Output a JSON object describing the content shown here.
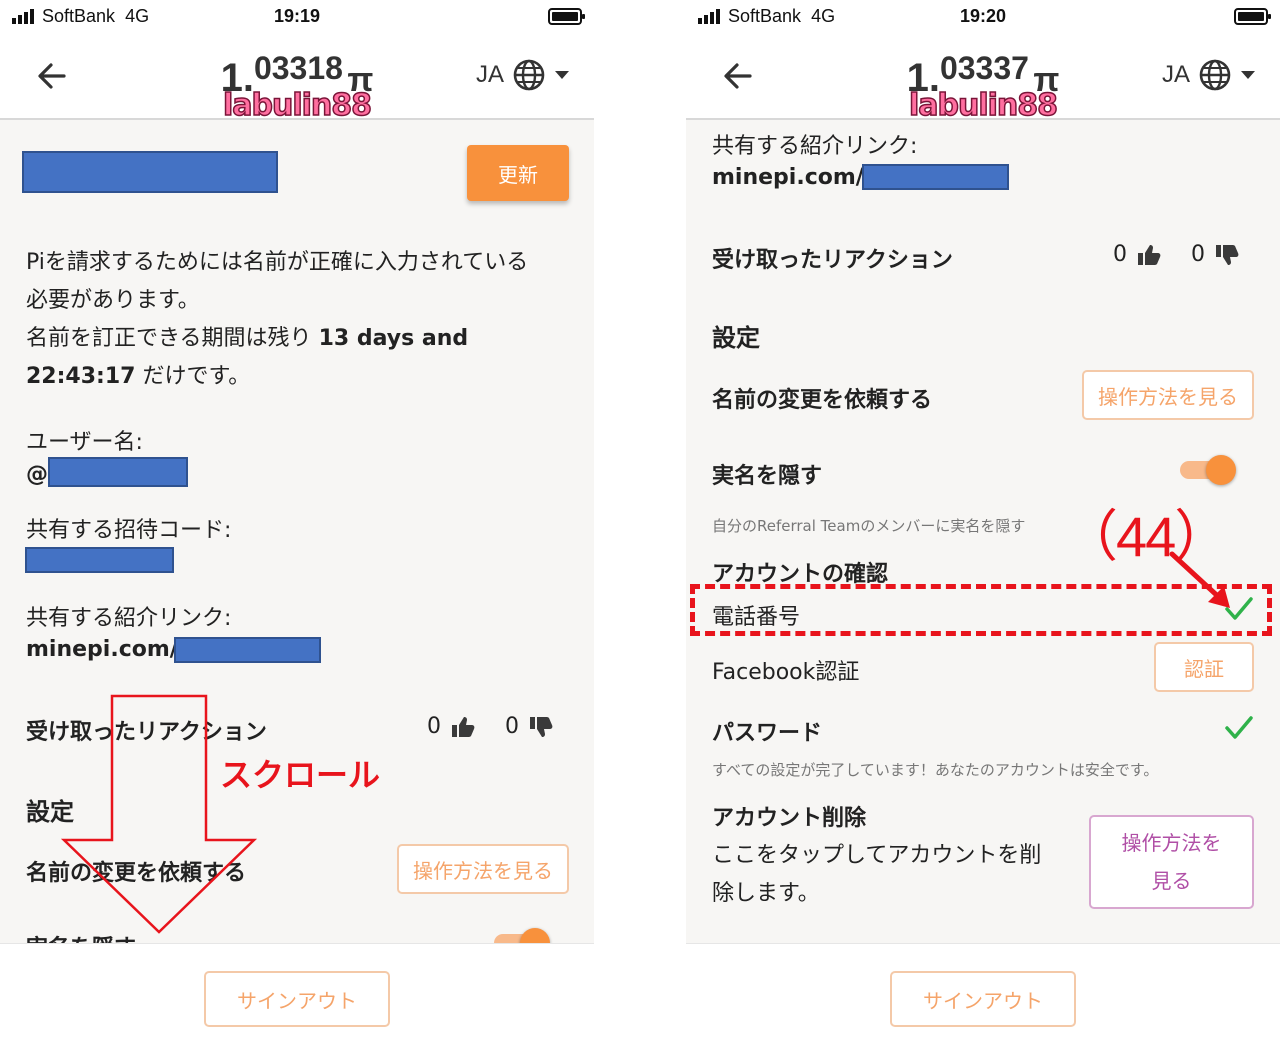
{
  "left_screen": {
    "status": {
      "carrier": "SoftBank",
      "network": "4G",
      "time": "19:19"
    },
    "header": {
      "balance_int": "1.",
      "balance_dec": "03318",
      "pi_symbol": "π",
      "watermark": "labulin88",
      "language": "JA"
    },
    "refresh_label": "更新",
    "notice_line1": "Piを請求するためには名前が正確に入力されている",
    "notice_line2": "必要があります。",
    "notice_line3_prefix": "名前を訂正できる期間は残り",
    "notice_bold1": "13 days and",
    "notice_bold2": "22:43:17",
    "notice_suffix": "だけです。",
    "username_label": "ユーザー名:",
    "username_prefix": "@",
    "invite_code_label": "共有する招待コード:",
    "referral_link_label": "共有する紹介リンク:",
    "referral_link_prefix": "minepi.com/",
    "reactions_label": "受け取ったリアクション",
    "likes": "0",
    "dislikes": "0",
    "settings_heading": "設定",
    "request_name_change": "名前の変更を依頼する",
    "how_to_label": "操作方法を見る",
    "hide_real_name": "実名を隠す",
    "signout_label": "サインアウト",
    "annotation_scroll": "スクロール"
  },
  "right_screen": {
    "status": {
      "carrier": "SoftBank",
      "network": "4G",
      "time": "19:20"
    },
    "header": {
      "balance_int": "1.",
      "balance_dec": "03337",
      "pi_symbol": "π",
      "watermark": "labulin88",
      "language": "JA"
    },
    "referral_link_label": "共有する紹介リンク:",
    "referral_link_prefix": "minepi.com/",
    "reactions_label": "受け取ったリアクション",
    "likes": "0",
    "dislikes": "0",
    "settings_heading": "設定",
    "request_name_change": "名前の変更を依頼する",
    "how_to_label": "操作方法を見る",
    "hide_real_name": "実名を隠す",
    "hide_real_name_desc": "自分のReferral Teamのメンバーに実名を隠す",
    "account_verification_heading": "アカウントの確認",
    "phone_number": "電話番号",
    "facebook_auth": "Facebook認証",
    "auth_button": "認証",
    "password": "パスワード",
    "security_complete": "すべての設定が完了しています！あなたのアカウントは安全です。",
    "delete_account_heading": "アカウント削除",
    "delete_account_line1": "ここをタップしてアカウントを削",
    "delete_account_line2": "除します。",
    "delete_how_to_line1": "操作方法を",
    "delete_how_to_line2": "見る",
    "signout_label": "サインアウト",
    "annotation_step": "（44）",
    "toggle_on": true,
    "phone_verified": true,
    "password_set": true
  },
  "colors": {
    "accent_orange": "#f8913c",
    "redaction_blue": "#4472c4",
    "annotation_red": "#e8141c",
    "check_green": "#2fb24a",
    "delete_button_purple": "#b04fa6"
  }
}
